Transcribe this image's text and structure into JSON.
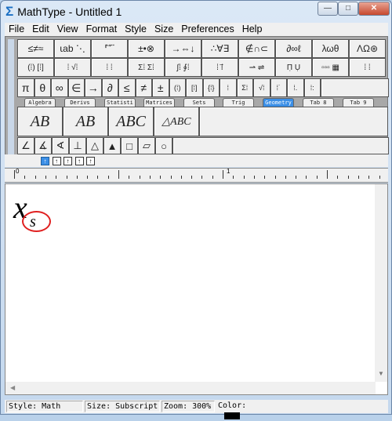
{
  "window": {
    "title": "MathType - Untitled 1",
    "minimize": "—",
    "maximize": "□",
    "close": "✕"
  },
  "menu": [
    "File",
    "Edit",
    "View",
    "Format",
    "Style",
    "Size",
    "Preferences",
    "Help"
  ],
  "palette_row1": [
    "≤≠≈",
    "⍳ab ⋱",
    "⸢ ⃗ ⃛",
    "±•⊗",
    "→⇔↓",
    "∴∀∃",
    "∉∩⊂",
    "∂∞ℓ",
    "λωθ",
    "ΛΩ⊛"
  ],
  "palette_row2": [
    "(⁞) [⁞]",
    "⁞ √⁞",
    "⁞ ⁞",
    "Σ⁞ Σ⁞",
    "∫⁞ ∮⁞",
    "⁞ ⁞⃗",
    "⇀ ⇌",
    "Π̣ Ụ",
    "▫▫▫ ▦",
    "⁞ ⁞"
  ],
  "palette_row3": [
    "π",
    "θ",
    "∞",
    "∈",
    "→",
    "∂",
    "≤",
    "≠",
    "±",
    "(⁞)",
    "[⁞]",
    "{⁞}",
    "⁞",
    "Σ⁞",
    "√⁞",
    "⁞˙",
    "⁞.",
    "⁞:"
  ],
  "tabs": [
    "Algebra",
    "Derivs",
    "Statisti",
    "Matrices",
    "Sets",
    "Trig",
    "Geometry",
    "Tab 8",
    "Tab 9"
  ],
  "active_tab": "Geometry",
  "geometry_large": [
    "AB",
    "AB",
    "ABC",
    "△ABC"
  ],
  "geometry_small": [
    "∠",
    "∡",
    "∢",
    "⊥",
    "△",
    "▲",
    "□",
    "▱",
    "○"
  ],
  "small_toolbar": [
    "↑",
    "↑",
    "↑",
    "↑",
    "↑"
  ],
  "ruler": {
    "labels": [
      "0",
      "1"
    ]
  },
  "document": {
    "base": "x",
    "subscript": "s",
    "highlight_color": "#e02020"
  },
  "status": {
    "style": "Style: Math",
    "size": "Size: Subscript",
    "zoom": "Zoom: 300%",
    "color_label": "Color:",
    "color_value": "#000000"
  }
}
